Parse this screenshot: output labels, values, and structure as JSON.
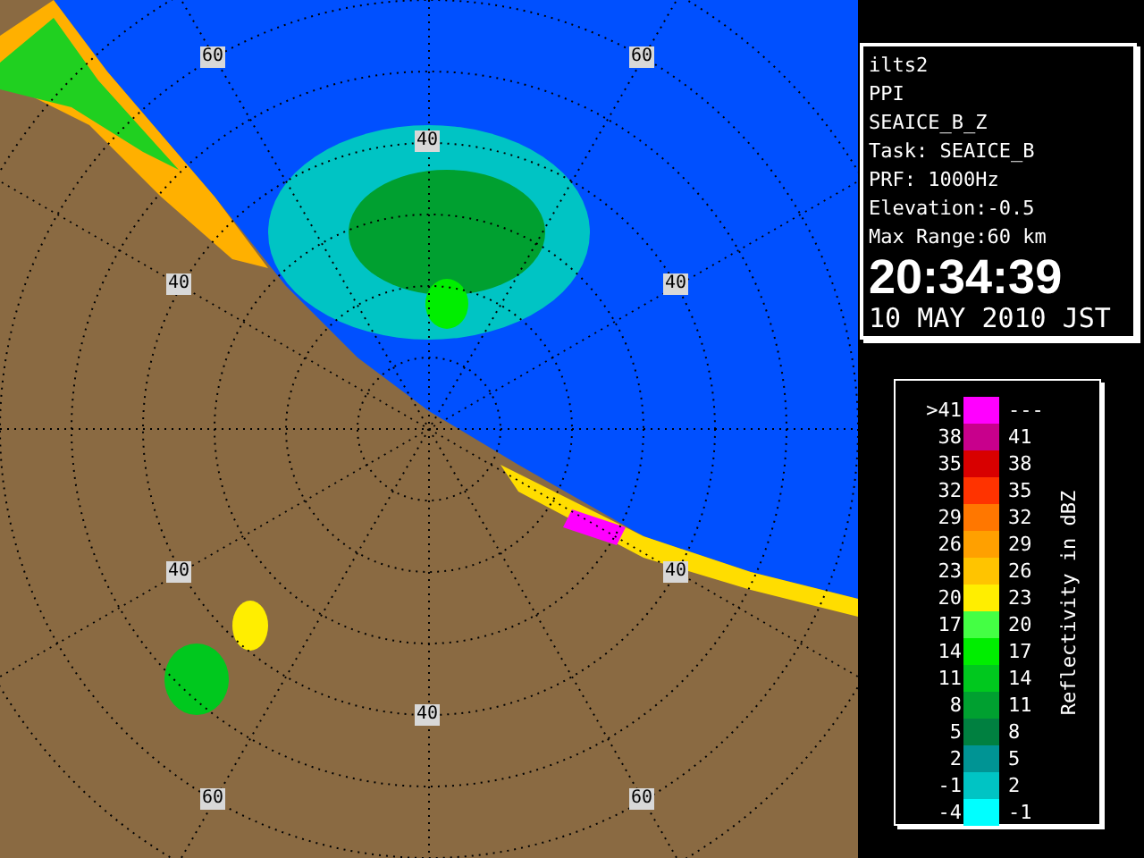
{
  "radar_map": {
    "range_labels": [
      "60",
      "60",
      "40",
      "40",
      "40",
      "40",
      "40",
      "40",
      "60",
      "60"
    ]
  },
  "info_panel": {
    "lines": [
      "ilts2",
      "PPI",
      "SEAICE_B_Z",
      "Task: SEAICE_B",
      "PRF: 1000Hz",
      "Elevation:-0.5",
      "Max Range:60 km"
    ],
    "time": "20:34:39",
    "date": "10 MAY 2010 JST"
  },
  "legend": {
    "title": "Reflectivity in dBZ",
    "rows": [
      {
        "low": ">41",
        "high": "---",
        "color": "#ff00ff"
      },
      {
        "low": "38",
        "high": "41",
        "color": "#c8008c"
      },
      {
        "low": "35",
        "high": "38",
        "color": "#d80000"
      },
      {
        "low": "32",
        "high": "35",
        "color": "#ff3300"
      },
      {
        "low": "29",
        "high": "32",
        "color": "#ff7700"
      },
      {
        "low": "26",
        "high": "29",
        "color": "#ffa000"
      },
      {
        "low": "23",
        "high": "26",
        "color": "#ffc400"
      },
      {
        "low": "20",
        "high": "23",
        "color": "#ffee00"
      },
      {
        "low": "17",
        "high": "20",
        "color": "#44ff44"
      },
      {
        "low": "14",
        "high": "17",
        "color": "#00ee00"
      },
      {
        "low": "11",
        "high": "14",
        "color": "#00c81e"
      },
      {
        "low": "8",
        "high": "11",
        "color": "#00a030"
      },
      {
        "low": "5",
        "high": "8",
        "color": "#008040"
      },
      {
        "low": "2",
        "high": "5",
        "color": "#009494"
      },
      {
        "low": "-1",
        "high": "2",
        "color": "#00c4c4"
      },
      {
        "low": "-4",
        "high": "-1",
        "color": "#00ffff"
      }
    ]
  }
}
